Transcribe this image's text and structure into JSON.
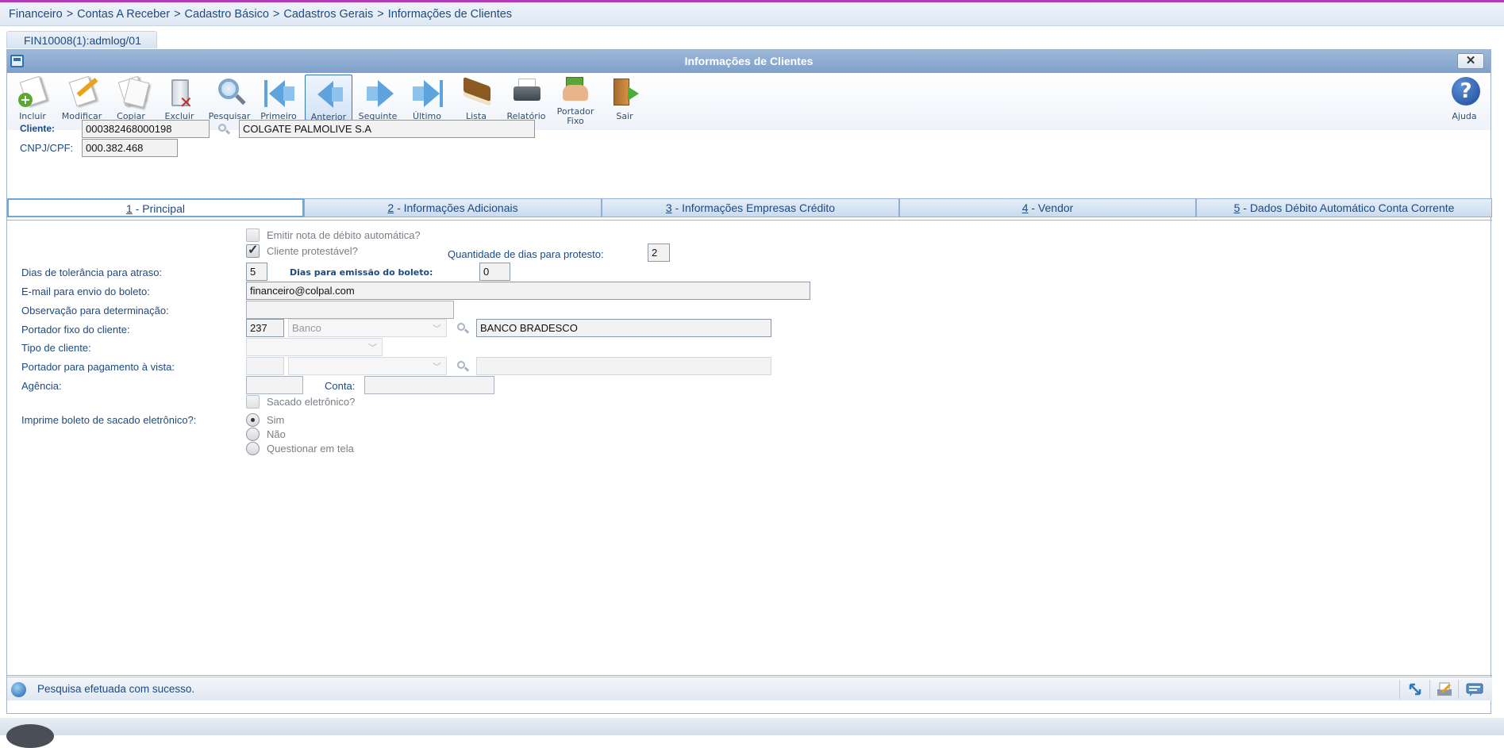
{
  "breadcrumb": [
    "Financeiro",
    "Contas A Receber",
    "Cadastro Básico",
    "Cadastros Gerais",
    "Informações de Clientes"
  ],
  "program_tab": "FIN10008(1):admlog/01",
  "window": {
    "title": "Informações de Clientes",
    "close_icon": "close-icon"
  },
  "toolbar": {
    "incluir": "Incluir",
    "modificar": "Modificar",
    "copiar": "Copiar",
    "excluir": "Excluir",
    "pesquisar": "Pesquisar",
    "primeiro": "Primeiro",
    "anterior": "Anterior",
    "seguinte": "Seguinte",
    "ultimo": "Último",
    "lista": "Lista",
    "relatorio": "Relatório",
    "portador_fixo_1": "Portador",
    "portador_fixo_2": "Fixo",
    "sair": "Sair",
    "ajuda": "Ajuda"
  },
  "header": {
    "cliente_label": "Cliente:",
    "cliente_code": "000382468000198",
    "cliente_name": "COLGATE PALMOLIVE S.A",
    "cnpj_label": "CNPJ/CPF:",
    "cnpj_value": "000.382.468"
  },
  "tabs": [
    {
      "num": "1",
      "label": " - Principal"
    },
    {
      "num": "2",
      "label": " - Informações Adicionais"
    },
    {
      "num": "3",
      "label": " - Informações Empresas Crédito"
    },
    {
      "num": "4",
      "label": " - Vendor"
    },
    {
      "num": "5",
      "label": " - Dados Débito Automático Conta Corrente"
    }
  ],
  "form": {
    "emitir_nota": "Emitir nota de débito automática?",
    "cliente_protestavel": "Cliente protestável?",
    "qtd_dias_protesto_label": "Quantidade de dias para protesto:",
    "qtd_dias_protesto": "2",
    "dias_tolerancia_label": "Dias de tolerância para atraso:",
    "dias_tolerancia": "5",
    "dias_emissao_label": "Dias para emissão do boleto:",
    "dias_emissao": "0",
    "email_label": "E-mail para envio do boleto:",
    "email": "financeiro@colpal.com",
    "observacao_label": "Observação para determinação:",
    "observacao": "",
    "portador_fixo_label": "Portador fixo do cliente:",
    "portador_fixo_code": "237",
    "portador_fixo_tipo": "Banco",
    "portador_fixo_nome": "BANCO BRADESCO",
    "tipo_cliente_label": "Tipo de cliente:",
    "portador_vista_label": "Portador para pagamento à vista:",
    "agencia_label": "Agência:",
    "conta_label": "Conta:",
    "sacado_eletronico": "Sacado eletrônico?",
    "imprime_boleto_label": "Imprime boleto de sacado eletrônico?:",
    "opt_sim": "Sim",
    "opt_nao": "Não",
    "opt_questionar": "Questionar em tela"
  },
  "status": {
    "message": "Pesquisa efetuada com sucesso."
  },
  "colors": {
    "accent": "#1d4a80",
    "titlebar": "#8aaad2",
    "active_tab_border": "#6aa7dc"
  }
}
